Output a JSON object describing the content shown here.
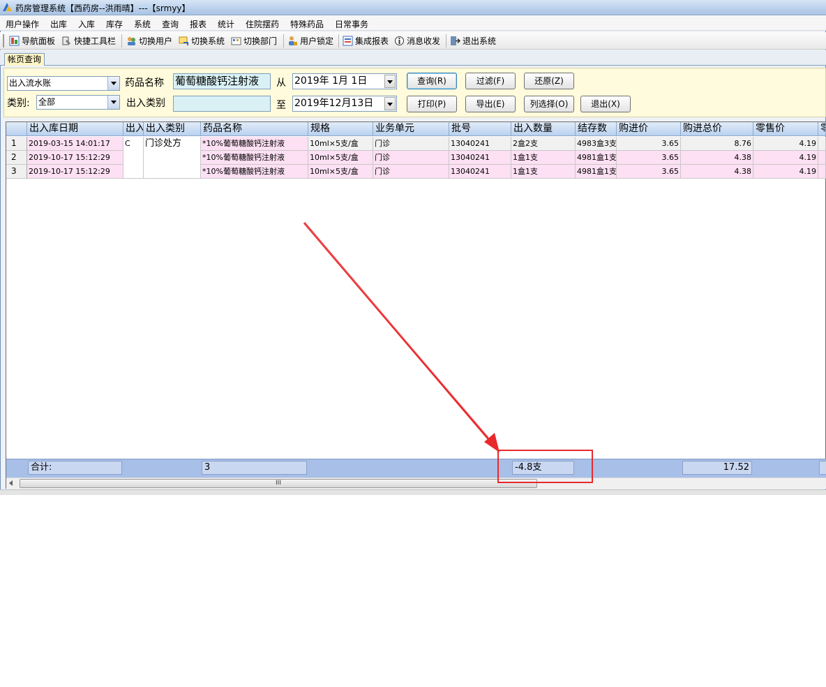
{
  "window": {
    "title": "药房管理系统【西药房--洪雨晴】---【srmyy】"
  },
  "menu": [
    "用户操作",
    "出库",
    "入库",
    "库存",
    "系统",
    "查询",
    "报表",
    "统计",
    "住院摆药",
    "特殊药品",
    "日常事务"
  ],
  "toolbar": [
    {
      "label": "导航面板",
      "icon": "navigation-panel-icon"
    },
    {
      "label": "快捷工具栏",
      "icon": "quick-toolbar-icon"
    },
    {
      "label": "切换用户",
      "icon": "switch-user-icon"
    },
    {
      "label": "切换系统",
      "icon": "switch-system-icon"
    },
    {
      "label": "切换部门",
      "icon": "switch-department-icon"
    },
    {
      "label": "用户锁定",
      "icon": "user-lock-icon"
    },
    {
      "label": "集成报表",
      "icon": "integrated-report-icon"
    },
    {
      "label": "消息收发",
      "icon": "message-icon"
    },
    {
      "label": "退出系统",
      "icon": "exit-system-icon"
    }
  ],
  "tab": {
    "label": "帐页查询"
  },
  "query": {
    "account_type": "出入流水账",
    "drug_name_label": "药品名称",
    "drug_name_value": "葡萄糖酸钙注射液",
    "from_label": "从",
    "from_date": "2019年 1月 1日",
    "category_label": "类别:",
    "category_value": "全部",
    "io_type_label": "出入类别",
    "io_type_value": "",
    "to_label": "至",
    "to_date": "2019年12月13日",
    "buttons": {
      "query": "查询(R)",
      "filter": "过滤(F)",
      "restore": "还原(Z)",
      "print": "打印(P)",
      "export": "导出(E)",
      "select_columns": "列选择(O)",
      "exit": "退出(X)"
    }
  },
  "grid": {
    "columns": [
      "出入库日期",
      "出入",
      "出入类别",
      "药品名称",
      "规格",
      "业务单元",
      "批号",
      "出入数量",
      "结存数",
      "购进价",
      "购进总价",
      "零售价",
      "零"
    ],
    "rows": [
      {
        "no": "1",
        "date": "2019-03-15 14:01:17",
        "io": "C",
        "io_type": "门诊处方",
        "drug": "*10%葡萄糖酸钙注射液",
        "spec": "10ml×5支/盒",
        "unit": "门诊",
        "batch": "13040241",
        "qty": "2盒2支",
        "stock": "4983盒3支",
        "price": "3.65",
        "total": "8.76",
        "retail": "4.19"
      },
      {
        "no": "2",
        "date": "2019-10-17 15:12:29",
        "io": "",
        "io_type": "",
        "drug": "*10%葡萄糖酸钙注射液",
        "spec": "10ml×5支/盒",
        "unit": "门诊",
        "batch": "13040241",
        "qty": "1盒1支",
        "stock": "4981盒1支",
        "price": "3.65",
        "total": "4.38",
        "retail": "4.19"
      },
      {
        "no": "3",
        "date": "2019-10-17 15:12:29",
        "io": "",
        "io_type": "",
        "drug": "*10%葡萄糖酸钙注射液",
        "spec": "10ml×5支/盒",
        "unit": "门诊",
        "batch": "13040241",
        "qty": "1盒1支",
        "stock": "4981盒1支",
        "price": "3.65",
        "total": "4.38",
        "retail": "4.19"
      }
    ]
  },
  "footer": {
    "total_label": "合计:",
    "row_count": "3",
    "qty_total": "-4.8支",
    "total_price": "17.52"
  },
  "scrollbar": {
    "thumb_grip": "III"
  },
  "colors": {
    "annotation": "#e8292c",
    "row_pink": "#fde0f3",
    "footer_bg": "#a8bfe8"
  }
}
